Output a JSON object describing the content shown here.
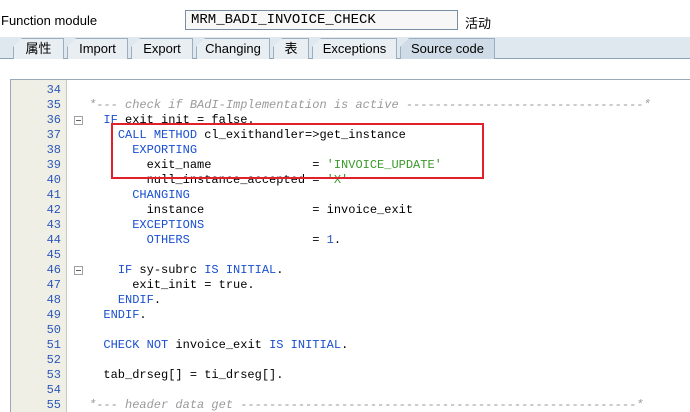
{
  "header": {
    "function_module_label": "Function module",
    "function_module_value": "MRM_BADI_INVOICE_CHECK",
    "status": "活动"
  },
  "tabs": [
    {
      "label": "属性",
      "active": false
    },
    {
      "label": "Import",
      "active": false
    },
    {
      "label": "Export",
      "active": false
    },
    {
      "label": "Changing",
      "active": false
    },
    {
      "label": "表",
      "active": false
    },
    {
      "label": "Exceptions",
      "active": false
    },
    {
      "label": "Source code",
      "active": true
    }
  ],
  "code_lines": [
    {
      "num": "34",
      "code": ""
    },
    {
      "num": "35",
      "code": "*--- check if BAdI-Implementation is active ---------------------------------*"
    },
    {
      "num": "36",
      "code": "  IF exit_init = false."
    },
    {
      "num": "37",
      "code": "    CALL METHOD cl_exithandler=>get_instance"
    },
    {
      "num": "38",
      "code": "      EXPORTING"
    },
    {
      "num": "39",
      "code": "        exit_name              = 'INVOICE_UPDATE'"
    },
    {
      "num": "40",
      "code": "        null_instance_accepted = 'X'"
    },
    {
      "num": "41",
      "code": "      CHANGING"
    },
    {
      "num": "42",
      "code": "        instance               = invoice_exit"
    },
    {
      "num": "43",
      "code": "      EXCEPTIONS"
    },
    {
      "num": "44",
      "code": "        OTHERS                 = 1."
    },
    {
      "num": "45",
      "code": ""
    },
    {
      "num": "46",
      "code": "    IF sy-subrc IS INITIAL."
    },
    {
      "num": "47",
      "code": "      exit_init = true."
    },
    {
      "num": "48",
      "code": "    ENDIF."
    },
    {
      "num": "49",
      "code": "  ENDIF."
    },
    {
      "num": "50",
      "code": ""
    },
    {
      "num": "51",
      "code": "  CHECK NOT invoice_exit IS INITIAL."
    },
    {
      "num": "52",
      "code": ""
    },
    {
      "num": "53",
      "code": "  tab_drseg[] = ti_drseg[]."
    },
    {
      "num": "54",
      "code": ""
    },
    {
      "num": "55",
      "code": "*--- header data get -------------------------------------------------------*"
    }
  ],
  "colors": {
    "keyword": "#1a4fd0",
    "comment": "#9a9a9a",
    "string": "#3a9a2a",
    "line_number": "#2c58b8",
    "highlight_border": "#e0202a"
  }
}
